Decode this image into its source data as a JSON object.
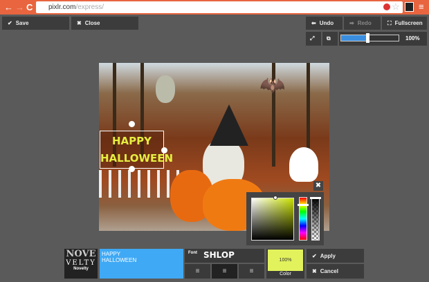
{
  "browser": {
    "url_host": "pixlr.com",
    "url_path": "/express/",
    "back_icon": "←",
    "forward_icon": "→",
    "reload_icon": "C"
  },
  "toolbar": {
    "save": "Save",
    "close": "Close",
    "undo": "Undo",
    "redo": "Redo",
    "fullscreen": "Fullscreen",
    "zoom_value": "100%",
    "zoom_fraction": 0.45
  },
  "canvas": {
    "text_overlay_line1": "HAPPY",
    "text_overlay_line2": "HALLOWEEN"
  },
  "bottom": {
    "font_preview_top": "NOVE",
    "font_preview_bottom": "VELTY",
    "font_style_name": "Novelty",
    "text_value": "HAPPY\nHALLOWEEN",
    "font_label": "Font",
    "font_name": "SHLOP",
    "opacity": "100%",
    "color_label": "Color",
    "apply": "Apply",
    "cancel": "Cancel"
  },
  "colors": {
    "accent": "#3fa9f5",
    "text_color": "#e2f25c",
    "chrome": "#e8653f"
  }
}
